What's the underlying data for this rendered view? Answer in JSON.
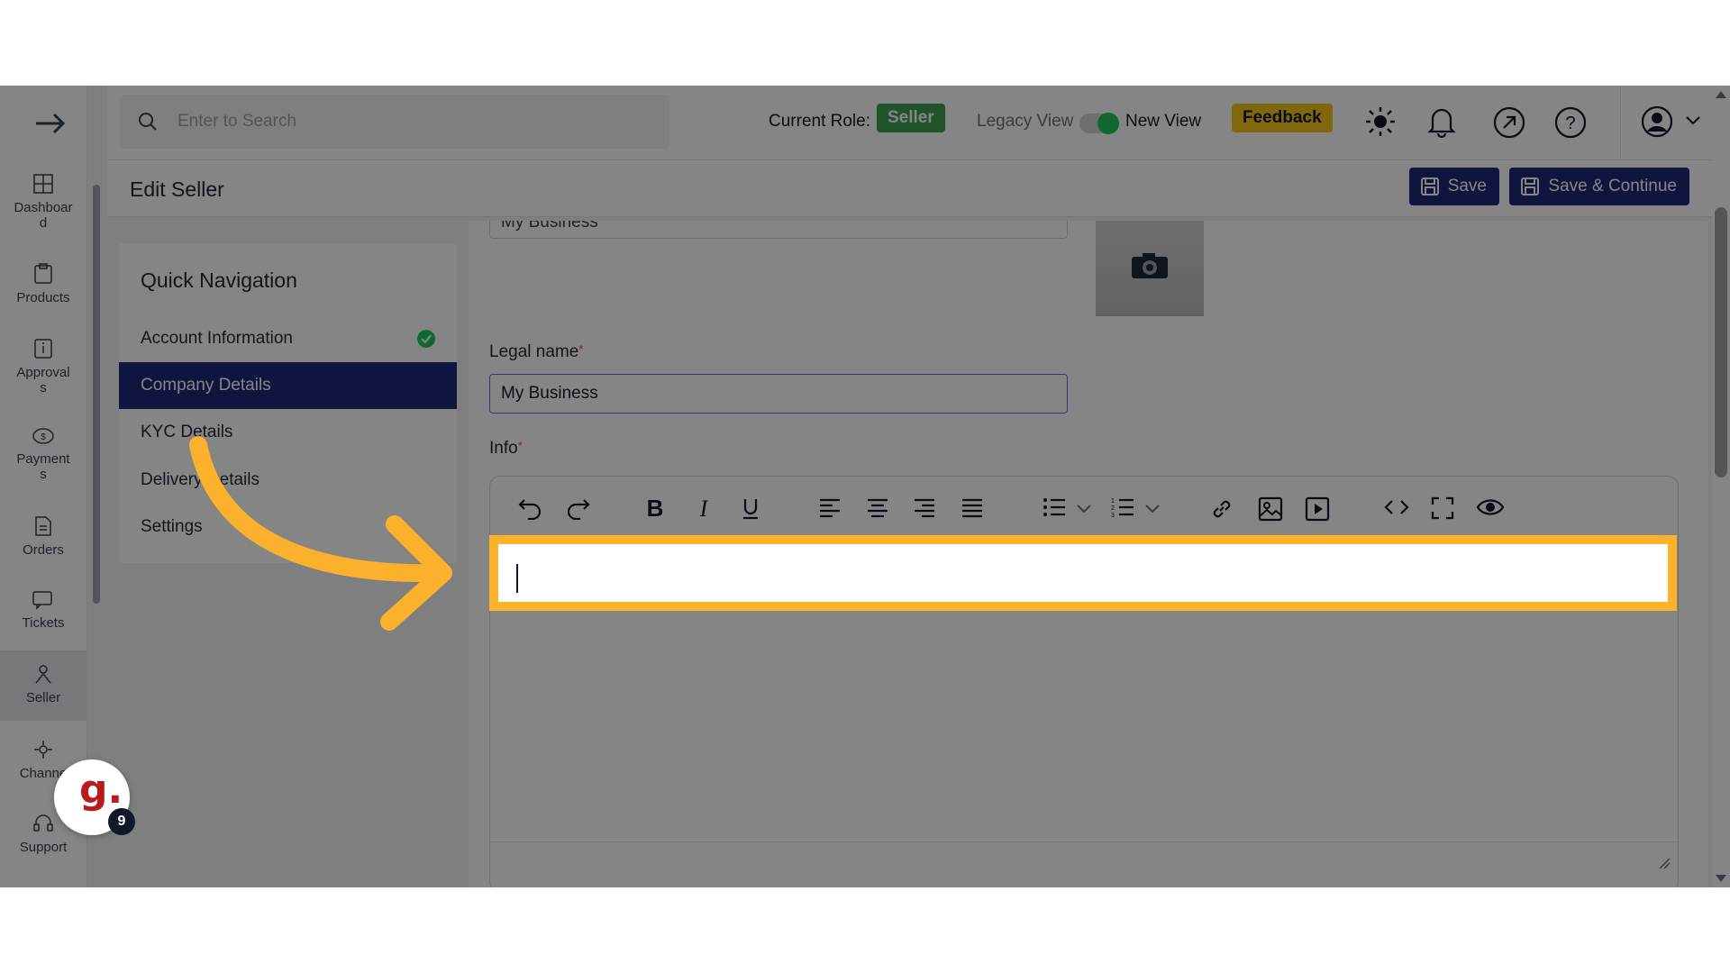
{
  "search": {
    "placeholder": "Enter to Search"
  },
  "topbar": {
    "role_label": "Current Role:",
    "role_value": "Seller",
    "legacy_label": "Legacy View",
    "new_label": "New View",
    "feedback_label": "Feedback",
    "colors": {
      "role_badge": "#3f9f4f",
      "feedback_badge": "#f5c518",
      "primary": "#1e2a78",
      "highlight": "#fbb12c"
    }
  },
  "sidebar": {
    "items": [
      {
        "label": "Dashboar",
        "label2": "d",
        "icon": "grid-icon"
      },
      {
        "label": "Products",
        "icon": "box-icon"
      },
      {
        "label": "Approval",
        "label2": "s",
        "icon": "info-box-icon"
      },
      {
        "label": "Payment",
        "label2": "s",
        "icon": "coins-icon"
      },
      {
        "label": "Orders",
        "icon": "document-icon"
      },
      {
        "label": "Tickets",
        "icon": "chat-icon"
      },
      {
        "label": "Seller",
        "icon": "seller-icon"
      },
      {
        "label": "Channe",
        "icon": "channels-icon"
      },
      {
        "label": "Support",
        "icon": "headset-icon"
      }
    ]
  },
  "header": {
    "title": "Edit Seller",
    "save_label": "Save",
    "save_continue_label": "Save & Continue"
  },
  "quick_nav": {
    "title": "Quick Navigation",
    "items": [
      {
        "label": "Account Information"
      },
      {
        "label": "Company Details"
      },
      {
        "label": "KYC Details"
      },
      {
        "label": "Delivery Details"
      },
      {
        "label": "Settings"
      }
    ]
  },
  "form": {
    "business_name_value": "My Business",
    "legal_name_label": "Legal name",
    "legal_name_value": "My Business",
    "info_label": "Info",
    "required_mark": "*"
  },
  "chat_widget": {
    "logo": "g.",
    "count": "9"
  }
}
